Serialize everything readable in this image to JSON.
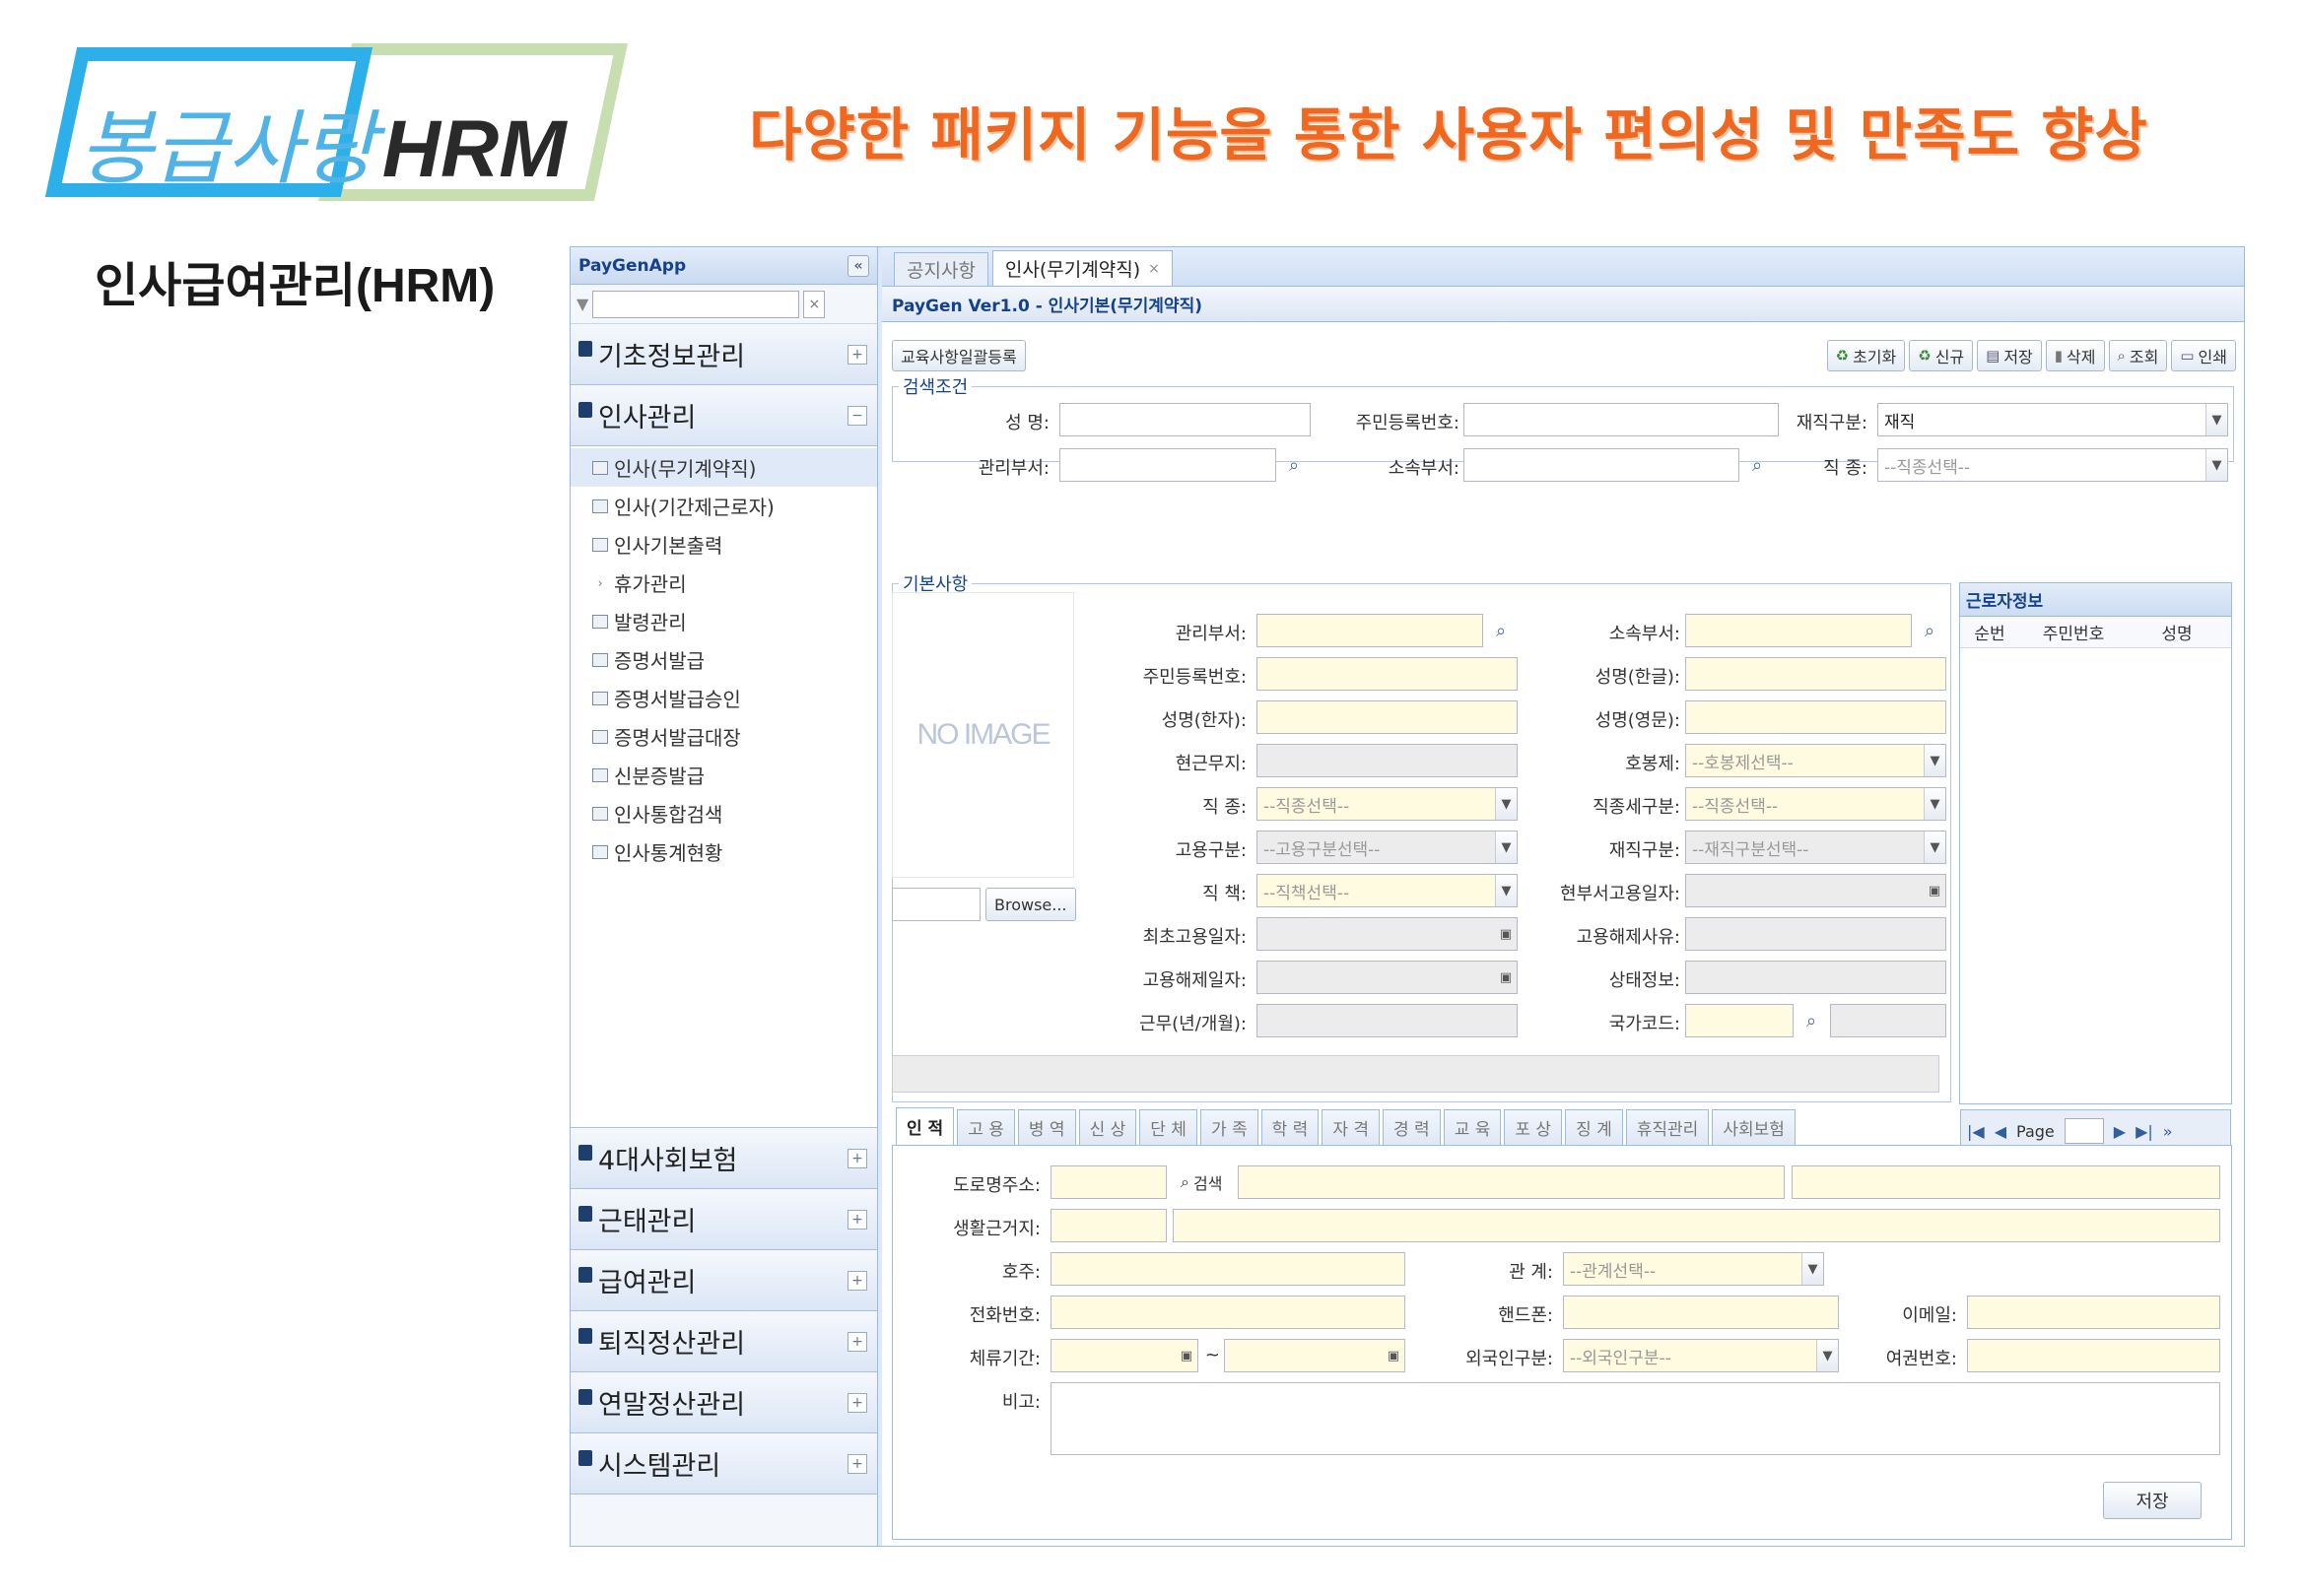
{
  "logo": {
    "korean": "봉급사랑",
    "brand": "HRM"
  },
  "headline": "다양한 패키지 기능을 통한 사용자 편의성 및 만족도 향상",
  "subtitle": "인사급여관리(HRM)",
  "sidebar": {
    "title": "PayGenApp",
    "collapse": "«",
    "groups_top": [
      {
        "label": "기초정보관리",
        "toggle": "+"
      },
      {
        "label": "인사관리",
        "toggle": "−"
      }
    ],
    "items": [
      {
        "label": "인사(무기계약직)",
        "icon": "doc-icon"
      },
      {
        "label": "인사(기간제근로자)",
        "icon": "doc-icon"
      },
      {
        "label": "인사기본출력",
        "icon": "doc-icon"
      },
      {
        "label": "휴가관리",
        "icon": "expand-arrow-icon"
      },
      {
        "label": "발령관리",
        "icon": "doc-icon"
      },
      {
        "label": "증명서발급",
        "icon": "doc-icon"
      },
      {
        "label": "증명서발급승인",
        "icon": "doc-icon"
      },
      {
        "label": "증명서발급대장",
        "icon": "doc-icon"
      },
      {
        "label": "신분증발급",
        "icon": "doc-icon"
      },
      {
        "label": "인사통합검색",
        "icon": "doc-icon"
      },
      {
        "label": "인사통계현황",
        "icon": "doc-icon"
      }
    ],
    "groups_bottom": [
      {
        "label": "4대사회보험",
        "toggle": "+"
      },
      {
        "label": "근태관리",
        "toggle": "+"
      },
      {
        "label": "급여관리",
        "toggle": "+"
      },
      {
        "label": "퇴직정산관리",
        "toggle": "+"
      },
      {
        "label": "연말정산관리",
        "toggle": "+"
      },
      {
        "label": "시스템관리",
        "toggle": "+"
      }
    ]
  },
  "tabs": [
    {
      "label": "공지사항"
    },
    {
      "label": "인사(무기계약직)",
      "close": "×"
    }
  ],
  "breadcrumb": "PayGen Ver1.0 - 인사기본(무기계약직)",
  "toolbar": {
    "left_button": "교육사항일괄등록",
    "buttons": [
      "초기화",
      "신규",
      "저장",
      "삭제",
      "조회",
      "인쇄"
    ]
  },
  "search": {
    "legend": "검색조건",
    "name": "성 명:",
    "rrn": "주민등록번호:",
    "employment": "재직구분:",
    "employment_value": "재직",
    "manage_dept": "관리부서:",
    "belong_dept": "소속부서:",
    "job_type": "직 종:",
    "job_type_ph": "--직종선택--"
  },
  "basic": {
    "legend": "기본사항",
    "photo": "NO IMAGE",
    "browse": "Browse...",
    "manage_dept": "관리부서:",
    "belong_dept": "소속부서:",
    "rrn": "주민등록번호:",
    "name_kr": "성명(한글):",
    "name_cn": "성명(한자):",
    "name_en": "성명(영문):",
    "status": "현근무지:",
    "grade": "호봉제:",
    "grade_ph": "--호봉제선택--",
    "job": "직 종:",
    "job_ph": "--직종선택--",
    "job_detail": "직종세구분:",
    "job_detail_ph": "--직종선택--",
    "emp_type": "고용구분:",
    "emp_type_ph": "--고용구분선택--",
    "work_type": "재직구분:",
    "work_type_ph": "--재직구분선택--",
    "position": "직 책:",
    "position_ph": "--직책선택--",
    "dept_date": "현부서고용일자:",
    "first_date": "최초고용일자:",
    "term_reason": "고용해제사유:",
    "term_date": "고용해제일자:",
    "state_info": "상태정보:",
    "service": "근무(년/개월):",
    "nation": "국가코드:"
  },
  "worker_panel": {
    "title": "근로자정보",
    "columns": [
      "순번",
      "주민번호",
      "성명"
    ],
    "page_label": "Page"
  },
  "subtabs": [
    "인 적",
    "고 용",
    "병 역",
    "신 상",
    "단 체",
    "가 족",
    "학 력",
    "자 격",
    "경 력",
    "교 육",
    "포 상",
    "징 계",
    "휴직관리",
    "사회보험"
  ],
  "detail": {
    "road_addr": "도로명주소:",
    "search_btn": "검색",
    "live_addr": "생활근거지:",
    "hoju": "호주:",
    "relation": "관 계:",
    "relation_ph": "--관계선택--",
    "phone": "전화번호:",
    "mobile": "핸드폰:",
    "email": "이메일:",
    "stay": "체류기간:",
    "tilde": "~",
    "foreign": "외국인구분:",
    "foreign_ph": "--외국인구분--",
    "passport": "여권번호:",
    "memo": "비고:",
    "save": "저장"
  }
}
